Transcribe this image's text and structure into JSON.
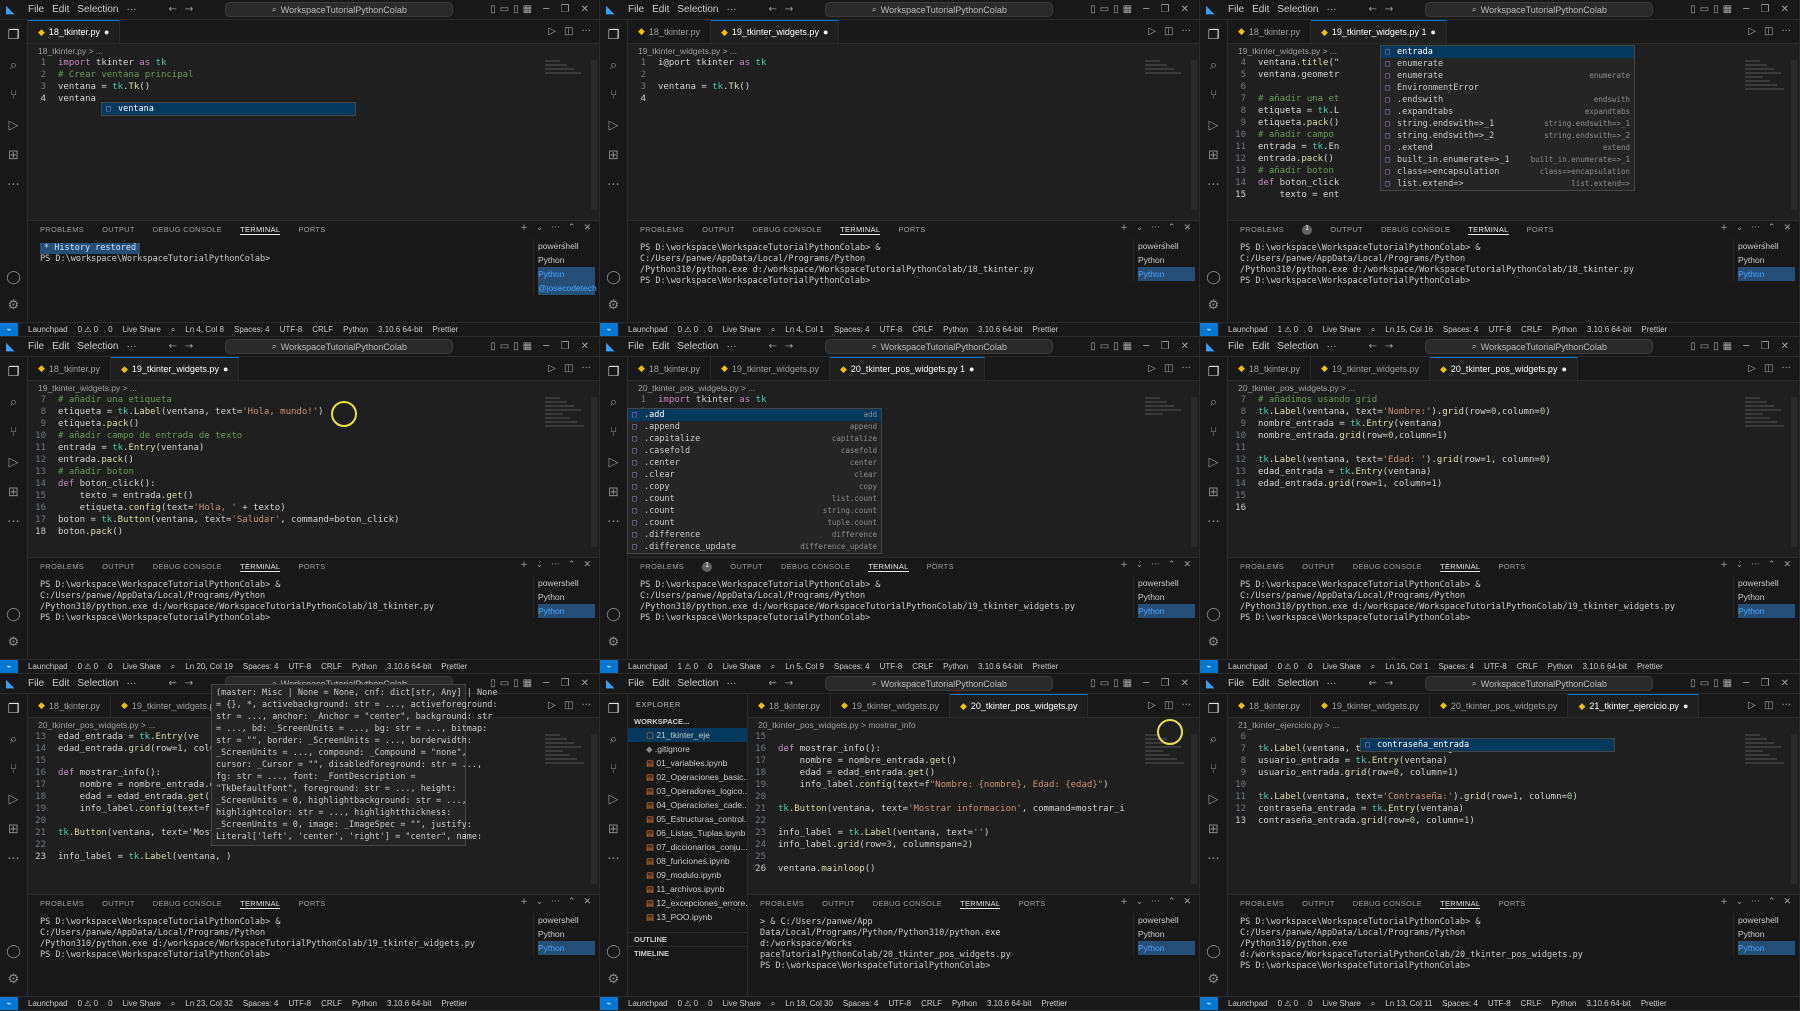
{
  "common": {
    "menu": [
      "File",
      "Edit",
      "Selection",
      "···"
    ],
    "search": "WorkspaceTutorialPythonColab",
    "panel_tabs": [
      "PROBLEMS",
      "OUTPUT",
      "DEBUG CONSOLE",
      "TERMINAL",
      "PORTS"
    ],
    "terminal_list": [
      "powershell",
      "Python",
      "Python"
    ],
    "status": {
      "launchpad": "Launchpad",
      "liveshare": "Live Share",
      "spaces": "Spaces: 4",
      "encoding": "UTF-8",
      "eol": "CRLF",
      "lang": "Python",
      "version": "3.10.6 64-bit",
      "prettier": "Prettier"
    }
  },
  "panes": [
    {
      "tabs": [
        {
          "label": "18_tkinter.py",
          "modified": true,
          "active": true
        }
      ],
      "breadcrumb": "18_tkinter.py > ...",
      "lines": [
        {
          "n": "1",
          "t": "import tkinter as tk"
        },
        {
          "n": "2",
          "t": "# Crear ventana principal"
        },
        {
          "n": "3",
          "t": "ventana = tk.Tk()"
        },
        {
          "n": "4",
          "t": "ventana"
        }
      ],
      "suggest": [
        "ventana"
      ],
      "terminal": [
        "* History restored",
        "",
        "PS D:\\workspace\\WorkspaceTutorialPythonColab>"
      ],
      "term_list_extra": "@josecodetech",
      "status": {
        "errors": "0 ⚠ 0",
        "ports": "0",
        "pos": "Ln 4, Col 8"
      }
    },
    {
      "tabs": [
        {
          "label": "18_tkinter.py",
          "modified": false,
          "active": false
        },
        {
          "label": "19_tkinter_widgets.py",
          "modified": true,
          "active": true
        }
      ],
      "breadcrumb": "19_tkinter_widgets.py > ...",
      "lines": [
        {
          "n": "1",
          "t": "i@port tkinter as tk"
        },
        {
          "n": "2",
          "t": ""
        },
        {
          "n": "3",
          "t": "ventana = tk.Tk()"
        },
        {
          "n": "4",
          "t": ""
        }
      ],
      "terminal": [
        "PS D:\\workspace\\WorkspaceTutorialPythonColab> & C:/Users/panwe/AppData/Local/Programs/Python",
        "/Python310/python.exe d:/workspace/WorkspaceTutorialPythonColab/18_tkinter.py",
        "PS D:\\workspace\\WorkspaceTutorialPythonColab>"
      ],
      "status": {
        "errors": "0 ⚠ 0",
        "ports": "0",
        "pos": "Ln 4, Col 1"
      }
    },
    {
      "tabs": [
        {
          "label": "18_tkinter.py",
          "modified": false,
          "active": false
        },
        {
          "label": "19_tkinter_widgets.py 1",
          "modified": true,
          "active": true
        }
      ],
      "breadcrumb": "19_tkinter_widgets.py > ...",
      "lines": [
        {
          "n": "4",
          "t": "ventana.title(\""
        },
        {
          "n": "5",
          "t": "ventana.geometr"
        },
        {
          "n": "6",
          "t": ""
        },
        {
          "n": "7",
          "t": "# añadir una et"
        },
        {
          "n": "8",
          "t": "etiqueta = tk.L"
        },
        {
          "n": "9",
          "t": "etiqueta.pack()"
        },
        {
          "n": "10",
          "t": "# añadir campo"
        },
        {
          "n": "11",
          "t": "entrada = tk.En"
        },
        {
          "n": "12",
          "t": "entrada.pack()"
        },
        {
          "n": "13",
          "t": "# añadir boton"
        },
        {
          "n": "14",
          "t": "def boton_click"
        },
        {
          "n": "15",
          "t": "    texto = ent"
        }
      ],
      "suggest": [
        "entrada",
        "enumerate",
        "enumerate",
        "EnvironmentError",
        ".endswith",
        ".expandtabs",
        "string.endswith=>_1",
        "string.endswith=>_2",
        ".extend",
        "built_in.enumerate=>_1",
        "class=>encapsulation",
        "list.extend=>"
      ],
      "suggest_detail": [
        "",
        "",
        "enumerate",
        "",
        "endswith",
        "expandtabs",
        "string.endswith=>_1",
        "string.endswith=>_2",
        "extend",
        "built_in.enumerate=>_1",
        "class=>encapsulation",
        "list.extend=>"
      ],
      "terminal": [
        "PS D:\\workspace\\WorkspaceTutorialPythonColab> & C:/Users/panwe/AppData/Local/Programs/Python",
        "/Python310/python.exe d:/workspace/WorkspaceTutorialPythonColab/18_tkinter.py",
        "PS D:\\workspace\\WorkspaceTutorialPythonColab>"
      ],
      "problems_badge": "1",
      "status": {
        "errors": "1 ⚠ 0",
        "ports": "0",
        "pos": "Ln 15, Col 16"
      }
    },
    {
      "tabs": [
        {
          "label": "18_tkinter.py",
          "modified": false,
          "active": false
        },
        {
          "label": "19_tkinter_widgets.py",
          "modified": true,
          "active": true
        }
      ],
      "breadcrumb": "19_tkinter_widgets.py > ...",
      "lines": [
        {
          "n": "7",
          "t": "# añadir una etiqueta"
        },
        {
          "n": "8",
          "t": "etiqueta = tk.Label(ventana, text='Hola, mundo!')"
        },
        {
          "n": "9",
          "t": "etiqueta.pack()"
        },
        {
          "n": "10",
          "t": "# añadir campo de entrada de texto"
        },
        {
          "n": "11",
          "t": "entrada = tk.Entry(ventana)"
        },
        {
          "n": "12",
          "t": "entrada.pack()"
        },
        {
          "n": "13",
          "t": "# añadir boton"
        },
        {
          "n": "14",
          "t": "def boton_click():"
        },
        {
          "n": "15",
          "t": "    texto = entrada.get()"
        },
        {
          "n": "16",
          "t": "    etiqueta.config(text='Hola, ' + texto)"
        },
        {
          "n": "17",
          "t": "boton = tk.Button(ventana, text='Saludar', command=boton_click)"
        },
        {
          "n": "18",
          "t": "boton.pack()"
        }
      ],
      "terminal": [
        "PS D:\\workspace\\WorkspaceTutorialPythonColab> & C:/Users/panwe/AppData/Local/Programs/Python",
        "/Python310/python.exe d:/workspace/WorkspaceTutorialPythonColab/18_tkinter.py",
        "PS D:\\workspace\\WorkspaceTutorialPythonColab>"
      ],
      "status": {
        "errors": "0 ⚠ 0",
        "ports": "0",
        "pos": "Ln 20, Col 19"
      }
    },
    {
      "tabs": [
        {
          "label": "18_tkinter.py",
          "modified": false,
          "active": false
        },
        {
          "label": "19_tkinter_widgets.py",
          "modified": false,
          "active": false
        },
        {
          "label": "20_tkinter_pos_widgets.py 1",
          "modified": true,
          "active": true
        }
      ],
      "breadcrumb": "20_tkinter_pos_widgets.py > ...",
      "lines": [
        {
          "n": "1",
          "t": "import tkinter as tk"
        },
        {
          "n": "2",
          "t": ""
        },
        {
          "n": "3",
          "t": "ventana = tk.Tk()"
        },
        {
          "n": "4",
          "t": "ventana.title(\"Ventana con grid\")"
        },
        {
          "n": "5",
          "t": "ventana."
        }
      ],
      "suggest": [
        ".add",
        ".append",
        ".capitalize",
        ".casefold",
        ".center",
        ".clear",
        ".copy",
        ".count",
        ".count",
        ".count",
        ".difference",
        ".difference_update"
      ],
      "suggest_detail": [
        "add",
        "append",
        "capitalize",
        "casefold",
        "center",
        "clear",
        "copy",
        "list.count",
        "string.count",
        "tuple.count",
        "difference",
        "difference_update"
      ],
      "terminal": [
        "PS D:\\workspace\\WorkspaceTutorialPythonColab> & C:/Users/panwe/AppData/Local/Programs/Python",
        "/Python310/python.exe d:/workspace/WorkspaceTutorialPythonColab/19_tkinter_widgets.py",
        "PS D:\\workspace\\WorkspaceTutorialPythonColab>"
      ],
      "problems_badge": "1",
      "status": {
        "errors": "1 ⚠ 0",
        "ports": "0",
        "pos": "Ln 5, Col 9"
      }
    },
    {
      "tabs": [
        {
          "label": "18_tkinter.py",
          "modified": false,
          "active": false
        },
        {
          "label": "19_tkinter_widgets.py",
          "modified": false,
          "active": false
        },
        {
          "label": "20_tkinter_pos_widgets.py",
          "modified": true,
          "active": true
        }
      ],
      "breadcrumb": "20_tkinter_pos_widgets.py > ...",
      "lines": [
        {
          "n": "7",
          "t": "# añadimos usando grid"
        },
        {
          "n": "8",
          "t": "tk.Label(ventana, text='Nombre:').grid(row=0,column=0)"
        },
        {
          "n": "9",
          "t": "nombre_entrada = tk.Entry(ventana)"
        },
        {
          "n": "10",
          "t": "nombre_entrada.grid(row=0,column=1)"
        },
        {
          "n": "11",
          "t": ""
        },
        {
          "n": "12",
          "t": "tk.Label(ventana, text='Edad: ').grid(row=1, column=0)"
        },
        {
          "n": "13",
          "t": "edad_entrada = tk.Entry(ventana)"
        },
        {
          "n": "14",
          "t": "edad_entrada.grid(row=1, column=1)"
        },
        {
          "n": "15",
          "t": ""
        },
        {
          "n": "16",
          "t": ""
        }
      ],
      "terminal": [
        "PS D:\\workspace\\WorkspaceTutorialPythonColab> & C:/Users/panwe/AppData/Local/Programs/Python",
        "/Python310/python.exe d:/workspace/WorkspaceTutorialPythonColab/19_tkinter_widgets.py",
        "PS D:\\workspace\\WorkspaceTutorialPythonColab>"
      ],
      "status": {
        "errors": "0 ⚠ 0",
        "ports": "0",
        "pos": "Ln 16, Col 1"
      }
    },
    {
      "tabs": [
        {
          "label": "18_tkinter.py",
          "modified": false,
          "active": false
        },
        {
          "label": "19_tkinter_widgets.py",
          "modified": false,
          "active": false
        }
      ],
      "breadcrumb": "20_tkinter_pos_widgets.py > ...",
      "lines": [
        {
          "n": "13",
          "t": "edad_entrada = tk.Entry(ve"
        },
        {
          "n": "14",
          "t": "edad_entrada.grid(row=1, column"
        },
        {
          "n": "15",
          "t": ""
        },
        {
          "n": "16",
          "t": "def mostrar_info():"
        },
        {
          "n": "17",
          "t": "    nombre = nombre_entrada.get("
        },
        {
          "n": "18",
          "t": "    edad = edad_entrada.get()"
        },
        {
          "n": "19",
          "t": "    info_label.config(text=f\"No"
        },
        {
          "n": "20",
          "t": ""
        },
        {
          "n": "21",
          "t": "tk.Button(ventana, text='Mostra"
        },
        {
          "n": "22",
          "t": ""
        },
        {
          "n": "23",
          "t": "info_label = tk.Label(ventana, )"
        }
      ],
      "hover": [
        "(master: Misc | None = None, cnf: dict[str, Any] | None",
        "= {}, *, activebackground: str = ..., activeforeground:",
        "str = ..., anchor: _Anchor = \"center\", background: str",
        "= ..., bd: _ScreenUnits = ..., bg: str = ..., bitmap:",
        "str = \"\", border: _ScreenUnits = ..., borderwidth:",
        "_ScreenUnits = ..., compound: _Compound = \"none\",",
        "cursor: _Cursor = \"\", disabledforeground: str = ...,",
        "fg: str = ..., font: _FontDescription =",
        "\"TkDefaultFont\", foreground: str = ..., height:",
        "_ScreenUnits = 0, highlightbackground: str = ...,",
        "highlightcolor: str = ..., highlightthickness:",
        "_ScreenUnits = 0, image: _ImageSpec = \"\", justify:",
        "Literal['left', 'center', 'right'] = \"center\", name:"
      ],
      "terminal": [
        "PS D:\\workspace\\WorkspaceTutorialPythonColab> & C:/Users/panwe/AppData/Local/Programs/Python",
        "/Python310/python.exe d:/workspace/WorkspaceTutorialPythonColab/19_tkinter_widgets.py",
        "PS D:\\workspace\\WorkspaceTutorialPythonColab>"
      ],
      "status": {
        "errors": "0 ⚠ 0",
        "ports": "0",
        "pos": "Ln 23, Col 32"
      }
    },
    {
      "explorer": {
        "title": "EXPLORER",
        "workspace": "WORKSPACE...",
        "items": [
          "21_tkinter_eje",
          ".gitignore",
          "01_variables.ipynb",
          "02_Operaciones_basic...",
          "03_Operadores_logico...",
          "04_Operaciones_cade...",
          "05_Estructuras_control...",
          "06_Listas_Tuplas.ipynb",
          "07_diccionarios_conju...",
          "08_funciones.ipynb",
          "09_modulo.ipynb",
          "11_archivos.ipynb",
          "12_excepciones_errore...",
          "13_POO.ipynb"
        ],
        "sections": [
          "OUTLINE",
          "TIMELINE"
        ]
      },
      "tabs": [
        {
          "label": "18_tkinter.py",
          "modified": false,
          "active": false
        },
        {
          "label": "19_tkinter_widgets.py",
          "modified": false,
          "active": false
        },
        {
          "label": "20_tkinter_pos_widgets.py",
          "modified": false,
          "active": true
        }
      ],
      "breadcrumb": "20_tkinter_pos_widgets.py > mostrar_info",
      "lines": [
        {
          "n": "15",
          "t": ""
        },
        {
          "n": "16",
          "t": "def mostrar_info():"
        },
        {
          "n": "17",
          "t": "    nombre = nombre_entrada.get()"
        },
        {
          "n": "18",
          "t": "    edad = edad_entrada.get()"
        },
        {
          "n": "19",
          "t": "    info_label.config(text=f\"Nombre: {nombre}, Edad: {edad}\")"
        },
        {
          "n": "20",
          "t": ""
        },
        {
          "n": "21",
          "t": "tk.Button(ventana, text='Mostrar informacion', command=mostrar_i"
        },
        {
          "n": "22",
          "t": ""
        },
        {
          "n": "23",
          "t": "info_label = tk.Label(ventana, text='')"
        },
        {
          "n": "24",
          "t": "info_label.grid(row=3, columnspan=2)"
        },
        {
          "n": "25",
          "t": ""
        },
        {
          "n": "26",
          "t": "ventana.mainloop()"
        }
      ],
      "terminal": [
        "> & C:/Users/panwe/App",
        "Data/Local/Programs/Python/Python310/python.exe d:/workspace/Works",
        "paceTutorialPythonColab/20_tkinter_pos_widgets.py",
        "PS D:\\workspace\\WorkspaceTutorialPythonColab>"
      ],
      "status": {
        "errors": "0 ⚠ 0",
        "ports": "0",
        "pos": "Ln 18, Col 30"
      }
    },
    {
      "tabs": [
        {
          "label": "18_tkinter.py",
          "modified": false,
          "active": false
        },
        {
          "label": "19_tkinter_widgets.py",
          "modified": false,
          "active": false
        },
        {
          "label": "20_tkinter_pos_widgets.py",
          "modified": false,
          "active": false
        },
        {
          "label": "21_tkinter_ejercicio.py",
          "modified": true,
          "active": true
        }
      ],
      "breadcrumb": "21_tkinter_ejercicio.py > ...",
      "lines": [
        {
          "n": "6",
          "t": ""
        },
        {
          "n": "7",
          "t": "tk.Label(ventana, text='Usuario:').grid(row=0, column=0)"
        },
        {
          "n": "8",
          "t": "usuario_entrada = tk.Entry(ventana)"
        },
        {
          "n": "9",
          "t": "usuario_entrada.grid(row=0, column=1)"
        },
        {
          "n": "10",
          "t": ""
        },
        {
          "n": "11",
          "t": "tk.Label(ventana, text='Contraseña:').grid(row=1, column=0)"
        },
        {
          "n": "12",
          "t": "contraseña_entrada = tk.Entry(ventana)"
        },
        {
          "n": "13",
          "t": "contraseña_entrada.grid(row=0, column=1)"
        }
      ],
      "suggest": [
        "contraseña_entrada"
      ],
      "terminal": [
        "PS D:\\workspace\\WorkspaceTutorialPythonColab> & C:/Users/panwe/AppData/Local/Programs/Python",
        "/Python310/python.exe d:/workspace/WorkspaceTutorialPythonColab/20_tkinter_pos_widgets.py",
        "PS D:\\workspace\\WorkspaceTutorialPythonColab>"
      ],
      "status": {
        "errors": "0 ⚠ 0",
        "ports": "0",
        "pos": "Ln 13, Col 11"
      }
    }
  ]
}
